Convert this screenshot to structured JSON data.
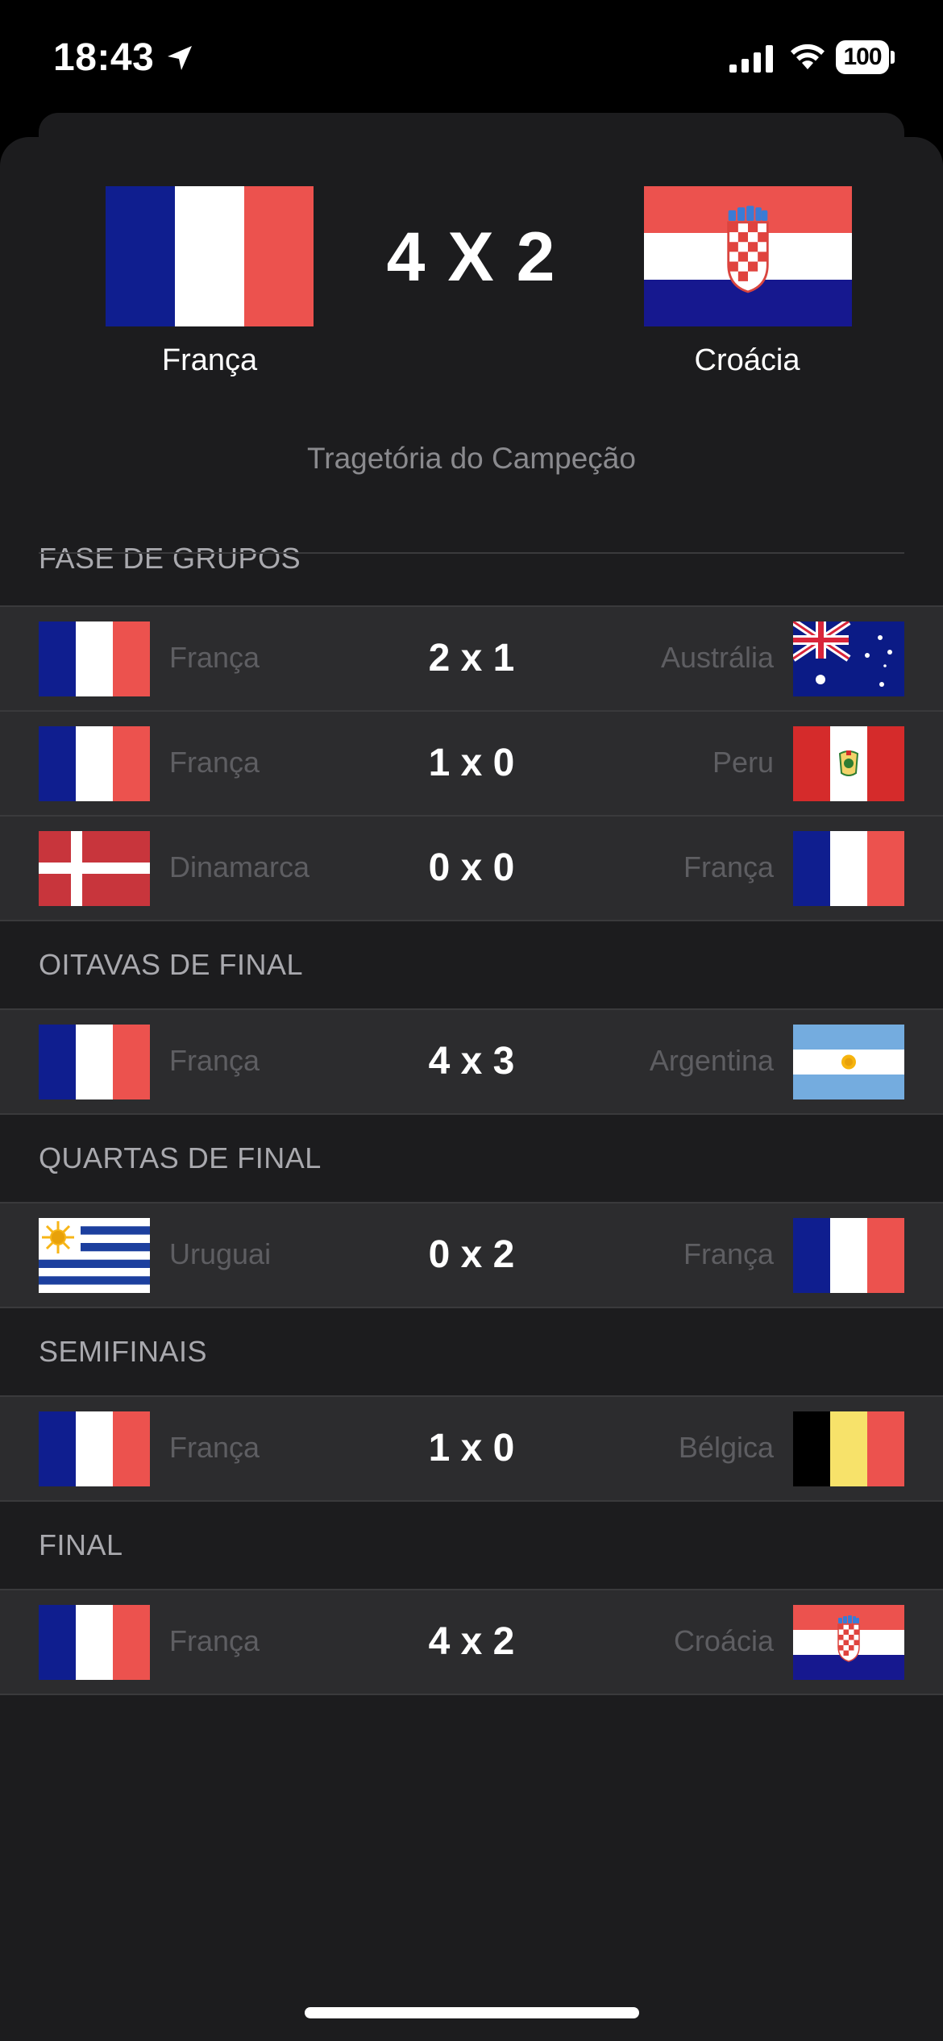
{
  "status_bar": {
    "time": "18:43",
    "battery": "100"
  },
  "final": {
    "home_team": "França",
    "away_team": "Croácia",
    "score": "4 X 2",
    "subtitle": "Tragetória do Campeção"
  },
  "stages": [
    {
      "title": "FASE DE GRUPOS",
      "matches": [
        {
          "home": "França",
          "home_flag": "france-flag",
          "score": "2 x 1",
          "away": "Austrália",
          "away_flag": "australia-flag"
        },
        {
          "home": "França",
          "home_flag": "france-flag",
          "score": "1 x 0",
          "away": "Peru",
          "away_flag": "peru-flag"
        },
        {
          "home": "Dinamarca",
          "home_flag": "denmark-flag",
          "score": "0 x 0",
          "away": "França",
          "away_flag": "france-flag"
        }
      ]
    },
    {
      "title": "OITAVAS DE FINAL",
      "matches": [
        {
          "home": "França",
          "home_flag": "france-flag",
          "score": "4 x 3",
          "away": "Argentina",
          "away_flag": "argentina-flag"
        }
      ]
    },
    {
      "title": "QUARTAS DE FINAL",
      "matches": [
        {
          "home": "Uruguai",
          "home_flag": "uruguay-flag",
          "score": "0 x 2",
          "away": "França",
          "away_flag": "france-flag"
        }
      ]
    },
    {
      "title": "SEMIFINAIS",
      "matches": [
        {
          "home": "França",
          "home_flag": "france-flag",
          "score": "1 x 0",
          "away": "Bélgica",
          "away_flag": "belgium-flag"
        }
      ]
    },
    {
      "title": "FINAL",
      "matches": [
        {
          "home": "França",
          "home_flag": "france-flag",
          "score": "4 x 2",
          "away": "Croácia",
          "away_flag": "croatia-flag"
        }
      ]
    }
  ]
}
